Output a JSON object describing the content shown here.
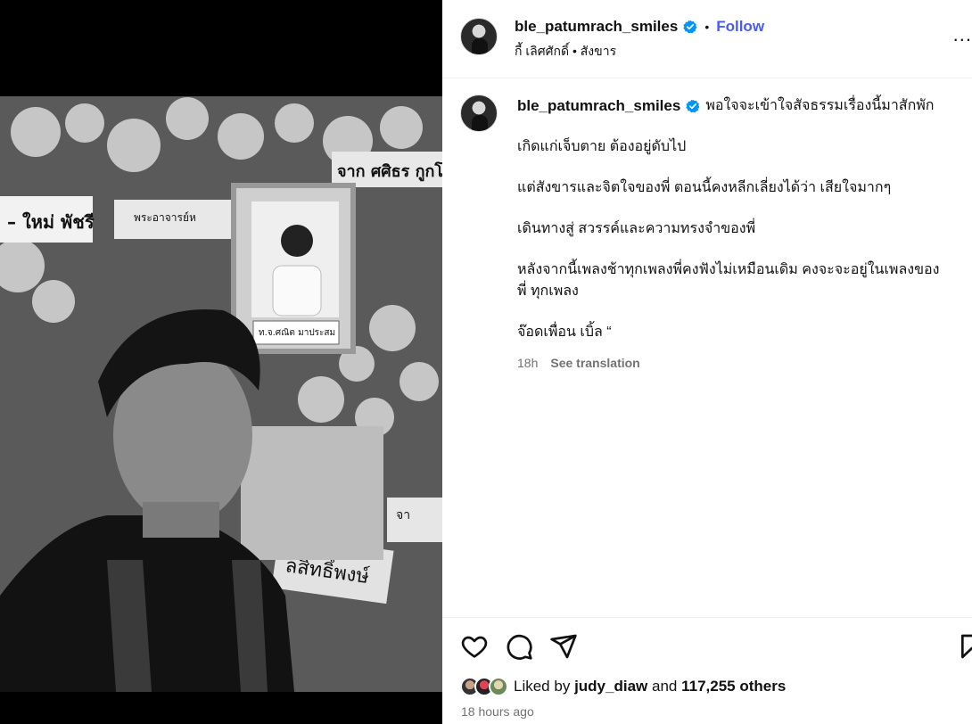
{
  "post": {
    "author": {
      "username": "ble_patumrach_smiles",
      "verified": true,
      "follow_label": "Follow",
      "separator": "•"
    },
    "location": "กี้ เลิศศักดิ์ • สังขาร",
    "more_label": "...",
    "caption": {
      "first_line": "พอใจจะเข้าใจสัจธรรมเรื่องนี้มาสักพัก",
      "lines": [
        "เกิดแก่เจ็บตาย ต้องอยู่ดับไป",
        "แต่สังขารและจิตใจของพี่ ตอนนี้คงหลีกเลี่ยงได้ว่า เสียใจมากๆ",
        "เดินทางสู่ สวรรค์และความทรงจำของพี่",
        "หลังจากนี้เพลงช้าทุกเพลงพี่คงฟังไม่เหมือนเดิม คงจะจะอยู่ในเพลงของ",
        "พี่ ทุกเพลง",
        "จ๊อดเพื่อน เบิ้ล “"
      ],
      "time": "18h",
      "see_translation": "See translation"
    },
    "likes": {
      "prefix": "Liked by",
      "user": "judy_diaw",
      "and": "and",
      "count": "117,255 others"
    },
    "time_ago": "18 hours ago"
  },
  "icons": {
    "like": "heart-icon",
    "comment": "comment-icon",
    "share": "share-icon",
    "save": "bookmark-icon",
    "verified": "verified-badge-icon",
    "more": "more-icon"
  },
  "colors": {
    "accent": "#4a5df0",
    "verified": "#0095f6",
    "muted": "#737373"
  }
}
